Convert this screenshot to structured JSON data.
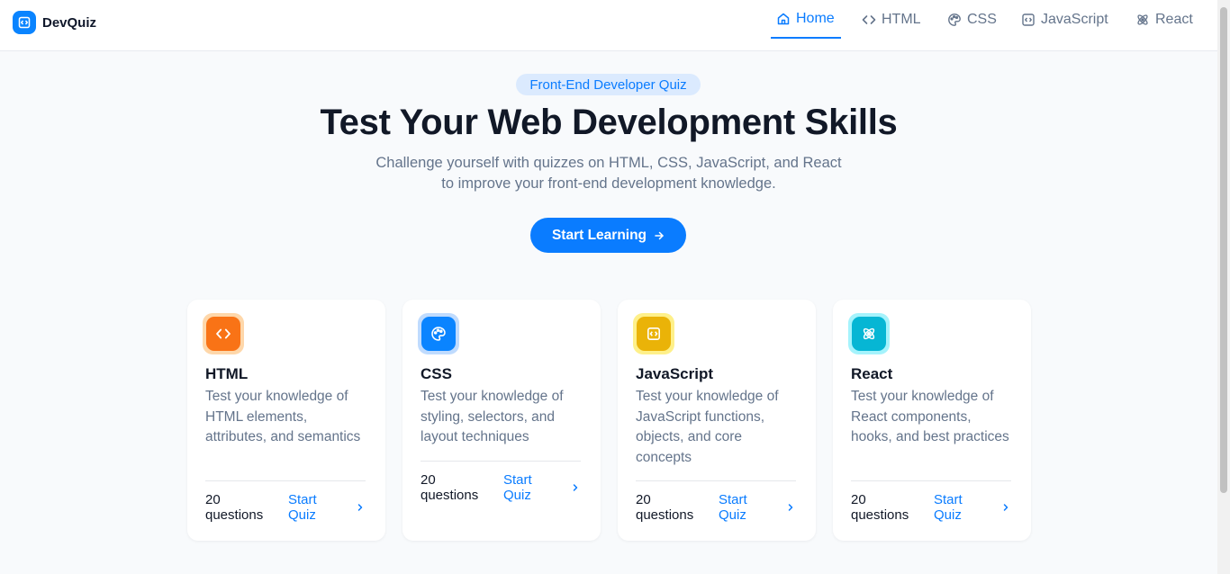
{
  "app": {
    "name": "DevQuiz",
    "brand_color": "#0a84ff"
  },
  "nav": {
    "items": [
      {
        "label": "Home",
        "icon": "home-icon",
        "active": true
      },
      {
        "label": "HTML",
        "icon": "code-brackets-icon",
        "active": false
      },
      {
        "label": "CSS",
        "icon": "palette-icon",
        "active": false
      },
      {
        "label": "JavaScript",
        "icon": "code-file-icon",
        "active": false
      },
      {
        "label": "React",
        "icon": "atom-icon",
        "active": false
      }
    ]
  },
  "hero": {
    "badge": "Front-End Developer Quiz",
    "title": "Test Your Web Development Skills",
    "subtitle_line1": "Challenge yourself with quizzes on HTML, CSS, JavaScript, and React",
    "subtitle_line2": "to improve your front-end development knowledge.",
    "cta_label": "Start Learning"
  },
  "cards": [
    {
      "title": "HTML",
      "description": "Test your knowledge of HTML elements, attributes, and semantics",
      "count_line1": "20",
      "count_line2": "questions",
      "link_line1": "Start",
      "link_line2": "Quiz",
      "icon": "code-brackets-icon",
      "color": "#f97316"
    },
    {
      "title": "CSS",
      "description": "Test your knowledge of styling, selectors, and layout techniques",
      "count_line1": "20",
      "count_line2": "questions",
      "link_line1": "Start",
      "link_line2": "Quiz",
      "icon": "palette-icon",
      "color": "#0a84ff"
    },
    {
      "title": "JavaScript",
      "description": "Test your knowledge of JavaScript functions, objects, and core concepts",
      "count_line1": "20",
      "count_line2": "questions",
      "link_line1": "Start",
      "link_line2": "Quiz",
      "icon": "code-file-icon",
      "color": "#eab308"
    },
    {
      "title": "React",
      "description": "Test your knowledge of React components, hooks, and best practices",
      "count_line1": "20",
      "count_line2": "questions",
      "link_line1": "Start",
      "link_line2": "Quiz",
      "icon": "atom-icon",
      "color": "#06b6d4"
    }
  ]
}
